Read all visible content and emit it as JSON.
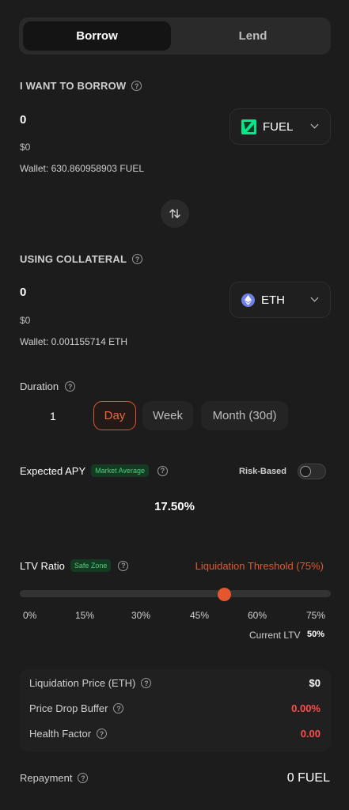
{
  "tabs": [
    {
      "label": "Borrow"
    },
    {
      "label": "Lend"
    }
  ],
  "borrow": {
    "label": "I WANT TO BORROW",
    "amount": "0",
    "usd": "$0",
    "wallet": "Wallet: 630.860958903 FUEL",
    "token": "FUEL"
  },
  "collateral": {
    "label": "USING COLLATERAL",
    "amount": "0",
    "usd": "$0",
    "wallet": "Wallet: 0.001155714 ETH",
    "token": "ETH"
  },
  "duration": {
    "label": "Duration",
    "value": "1",
    "options": [
      "Day",
      "Week",
      "Month (30d)"
    ],
    "selected": "Day"
  },
  "apy": {
    "label": "Expected APY",
    "badge": "Market Average",
    "risk_label": "Risk-Based",
    "risk_enabled": false,
    "value": "17.50%"
  },
  "ltv": {
    "label": "LTV Ratio",
    "badge": "Safe Zone",
    "threshold": "Liquidation Threshold (75%)",
    "ticks": [
      "0%",
      "15%",
      "30%",
      "45%",
      "60%",
      "75%"
    ],
    "current_label": "Current LTV",
    "current_value": "50%",
    "slider_fraction": 0.67
  },
  "details": {
    "liq_price_label": "Liquidation Price (ETH)",
    "liq_price_value": "$0",
    "buffer_label": "Price Drop Buffer",
    "buffer_value": "0.00%",
    "health_label": "Health Factor",
    "health_value": "0.00"
  },
  "repayment": {
    "label": "Repayment",
    "value": "0 FUEL"
  },
  "colors": {
    "accent": "#e4572e",
    "danger": "#ff4d4d",
    "safe": "#45d27c",
    "fuel": "#00e68a",
    "eth": "#6f7fe8"
  }
}
